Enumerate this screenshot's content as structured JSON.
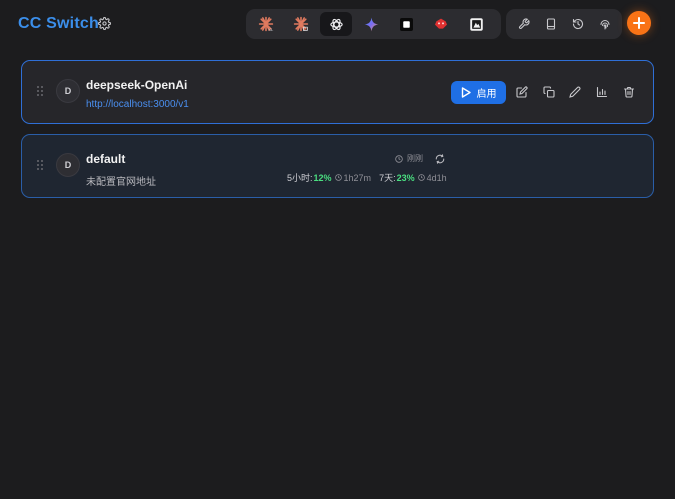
{
  "header": {
    "title": "CC Switch",
    "settings_icon": "gear-icon",
    "app_tabs": [
      {
        "name": "claude-icon",
        "active": false
      },
      {
        "name": "claude-alt-icon",
        "active": false
      },
      {
        "name": "openai-icon",
        "active": true
      },
      {
        "name": "gemini-icon",
        "active": false
      },
      {
        "name": "square-icon",
        "active": false
      },
      {
        "name": "red-app-icon",
        "active": false
      },
      {
        "name": "image-app-icon",
        "active": false
      }
    ],
    "tools": [
      "wrench-icon",
      "book-icon",
      "history-icon",
      "fingerprint-icon"
    ],
    "add_icon": "plus-icon"
  },
  "providers": [
    {
      "avatar": "D",
      "name": "deepseek-OpenAi",
      "url": "http://localhost:3000/v1",
      "enable_label": "启用"
    },
    {
      "avatar": "D",
      "name": "default",
      "subtitle": "未配置官网地址",
      "refresh_text": "刚刚",
      "usage": {
        "five_hour_label": "5小时:",
        "five_hour_pct": "12%",
        "five_hour_reset": "1h27m",
        "seven_day_label": "7天:",
        "seven_day_pct": "23%",
        "seven_day_reset": "4d1h"
      }
    }
  ],
  "colors": {
    "accent": "#3b8eea",
    "primary_button": "#1f6fe5",
    "add_button": "#f97316",
    "usage_green": "#4ade80",
    "background": "#1c1c1e"
  }
}
